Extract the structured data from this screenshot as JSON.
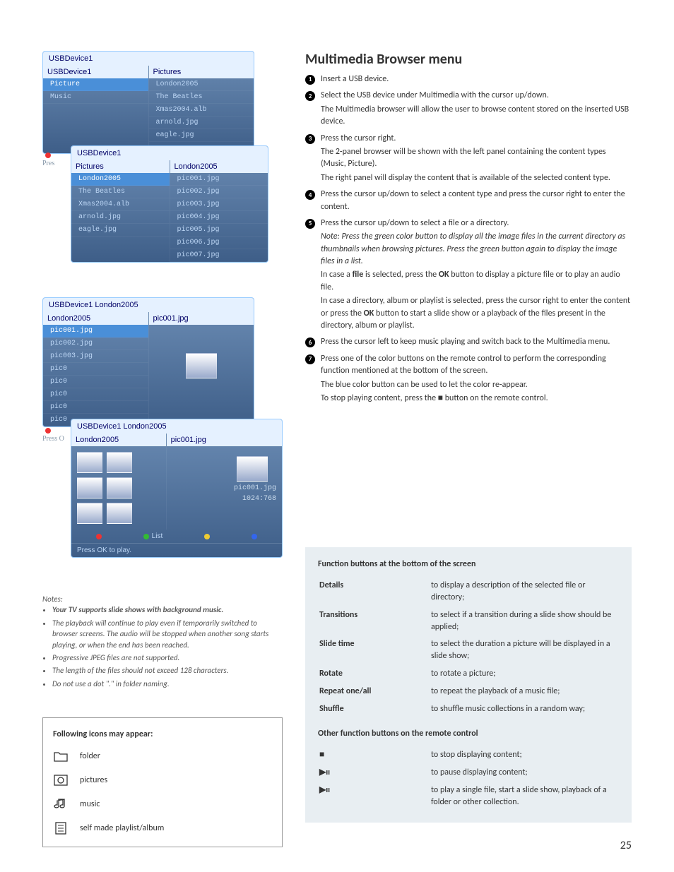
{
  "page_number": "25",
  "browsers": {
    "bc1": "USBDevice1",
    "b1_left_head": "USBDevice1",
    "b1_right_head": "Pictures",
    "b1_left": [
      "Picture",
      "Music"
    ],
    "b1_right": [
      "London2005",
      "The Beatles",
      "Xmas2004.alb",
      "arnold.jpg",
      "eagle.jpg"
    ],
    "b2_bc": "USBDevice1",
    "b2_left_head": "Pictures",
    "b2_right_head": "London2005",
    "b2_left": [
      "London2005",
      "The Beatles",
      "Xmas2004.alb",
      "arnold.jpg",
      "eagle.jpg"
    ],
    "b2_right": [
      "pic001.jpg",
      "pic002.jpg",
      "pic003.jpg",
      "pic004.jpg",
      "pic005.jpg",
      "pic006.jpg",
      "pic007.jpg"
    ],
    "b2_foot": "Pres",
    "b3_bc": "USBDevice1  London2005",
    "b3_left_head": "London2005",
    "b3_right_head": "pic001.jpg",
    "b3_left": [
      "pic001.jpg",
      "pic002.jpg",
      "pic003.jpg",
      "pic0",
      "pic0",
      "pic0",
      "pic0",
      "pic0"
    ],
    "b4_bc": "USBDevice1  London2005",
    "b4_left_head": "London2005",
    "b4_right_head": "pic001.jpg",
    "b4_meta1": "pic001.jpg",
    "b4_meta2": "1024:768",
    "b4_list_label": "List",
    "b4_foot": "Press OK to play.",
    "foot_press": "Press O"
  },
  "notes": {
    "head": "Notes:",
    "items": [
      "Your TV supports slide shows with background music.",
      "The playback will continue to play even if temporarily switched to browser screens. The audio will be stopped when another song starts playing, or when the end has been reached.",
      "Progressive JPEG files are not supported.",
      "The length of the files should not exceed 128 characters.",
      "Do not use a dot \".\" in folder naming."
    ]
  },
  "icons_box": {
    "title": "Following icons may appear:",
    "rows": [
      {
        "name": "folder-icon",
        "label": "folder"
      },
      {
        "name": "pictures-icon",
        "label": "pictures"
      },
      {
        "name": "music-icon",
        "label": "music"
      },
      {
        "name": "playlist-icon",
        "label": "self made playlist/album"
      }
    ]
  },
  "main": {
    "title": "Multimedia Browser menu",
    "steps": {
      "s1": "Insert a USB device.",
      "s2a": "Select the USB device under Multimedia with the cursor up/down.",
      "s2b": "The Multimedia browser will allow the user to browse content stored on the inserted USB device.",
      "s3a": "Press the cursor right.",
      "s3b": "The 2-panel browser will be shown with the left panel containing the content types (Music, Picture).",
      "s3c": "The right panel will display the content that is available of the selected content type.",
      "s4": "Press the cursor up/down to select a content type and press the cursor right to enter the content.",
      "s5a": "Press the cursor up/down to select a file or a directory.",
      "s5note": "Note: Press the green color button to display all the image files in the current directory as thumbnails when browsing pictures. Press the green button again to display the image files in a list.",
      "s5b_pre": "In case a ",
      "s5b_bold1": "file",
      "s5b_mid": " is selected, press the ",
      "s5b_bold2": "OK",
      "s5b_post": " button to display a picture file or to play an audio file.",
      "s5c_pre": "In case a directory, album or playlist is selected, press the cursor right to enter the content or press the ",
      "s5c_bold": "OK",
      "s5c_post": " button to start a slide show or a playback of the files present in the directory, album or playlist.",
      "s6": "Press the cursor left to keep music playing and switch back to the Multimedia menu.",
      "s7a": "Press one of the color buttons on the remote control to perform the corresponding function mentioned at the bottom of the screen.",
      "s7b": "The blue color button can be used to let the color re-appear.",
      "s7c": "To stop playing content, press the ■ button on the remote control."
    }
  },
  "func": {
    "title1": "Function buttons at the bottom of the screen",
    "rows1": [
      {
        "k": "Details",
        "v": "to display a description of the selected file or directory;"
      },
      {
        "k": "Transitions",
        "v": "to select if a transition during a slide show should be applied;"
      },
      {
        "k": "Slide time",
        "v": "to select the duration a picture will be displayed in a slide show;"
      },
      {
        "k": "Rotate",
        "v": "to rotate a picture;"
      },
      {
        "k": "Repeat one/all",
        "v": "to repeat the playback of a music file;"
      },
      {
        "k": "Shuffle",
        "v": "to shuffle music collections in a random way;"
      }
    ],
    "title2": "Other function buttons on the remote control",
    "rows2": [
      {
        "k": "■",
        "v": "to stop displaying content;"
      },
      {
        "k": "▶ıı",
        "v": "to pause displaying content;"
      },
      {
        "k": "▶ıı",
        "v": "to play a single file, start a slide show, playback of a folder or other collection."
      }
    ]
  }
}
